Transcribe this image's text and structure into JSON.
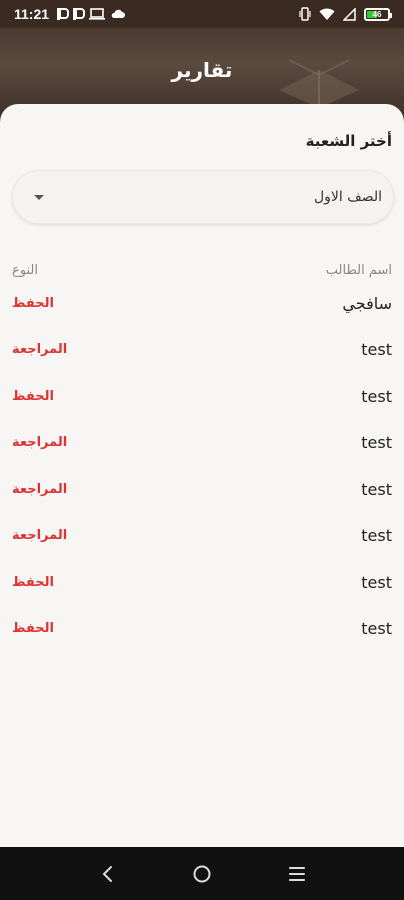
{
  "status_bar": {
    "time": "11:21",
    "battery_level": "46",
    "icons": [
      "p-icon",
      "p-icon",
      "laptop-icon",
      "cloud-icon",
      "vibrate-icon",
      "wifi-icon",
      "signal-icon",
      "battery-icon"
    ],
    "battery_color": "#33cc33"
  },
  "header": {
    "title": "تقارير"
  },
  "filter": {
    "label": "أختر الشعبة",
    "selected": "الصف الاول"
  },
  "table": {
    "columns": {
      "student_name": "اسم الطالب",
      "type": "النوع"
    },
    "rows": [
      {
        "name": "سافجي",
        "type": "الحفظ"
      },
      {
        "name": "test",
        "type": "المراجعة"
      },
      {
        "name": "test",
        "type": "الحفظ"
      },
      {
        "name": "test",
        "type": "المراجعة"
      },
      {
        "name": "test",
        "type": "المراجعة"
      },
      {
        "name": "test",
        "type": "المراجعة"
      },
      {
        "name": "test",
        "type": "الحفظ"
      },
      {
        "name": "test",
        "type": "الحفظ"
      }
    ]
  },
  "colors": {
    "type_text": "#dd3333",
    "header_bg": "#4a3a30",
    "sheet_bg": "#f7f6f5"
  },
  "nav": {
    "buttons": [
      "back-icon",
      "home-icon",
      "recents-icon"
    ]
  }
}
